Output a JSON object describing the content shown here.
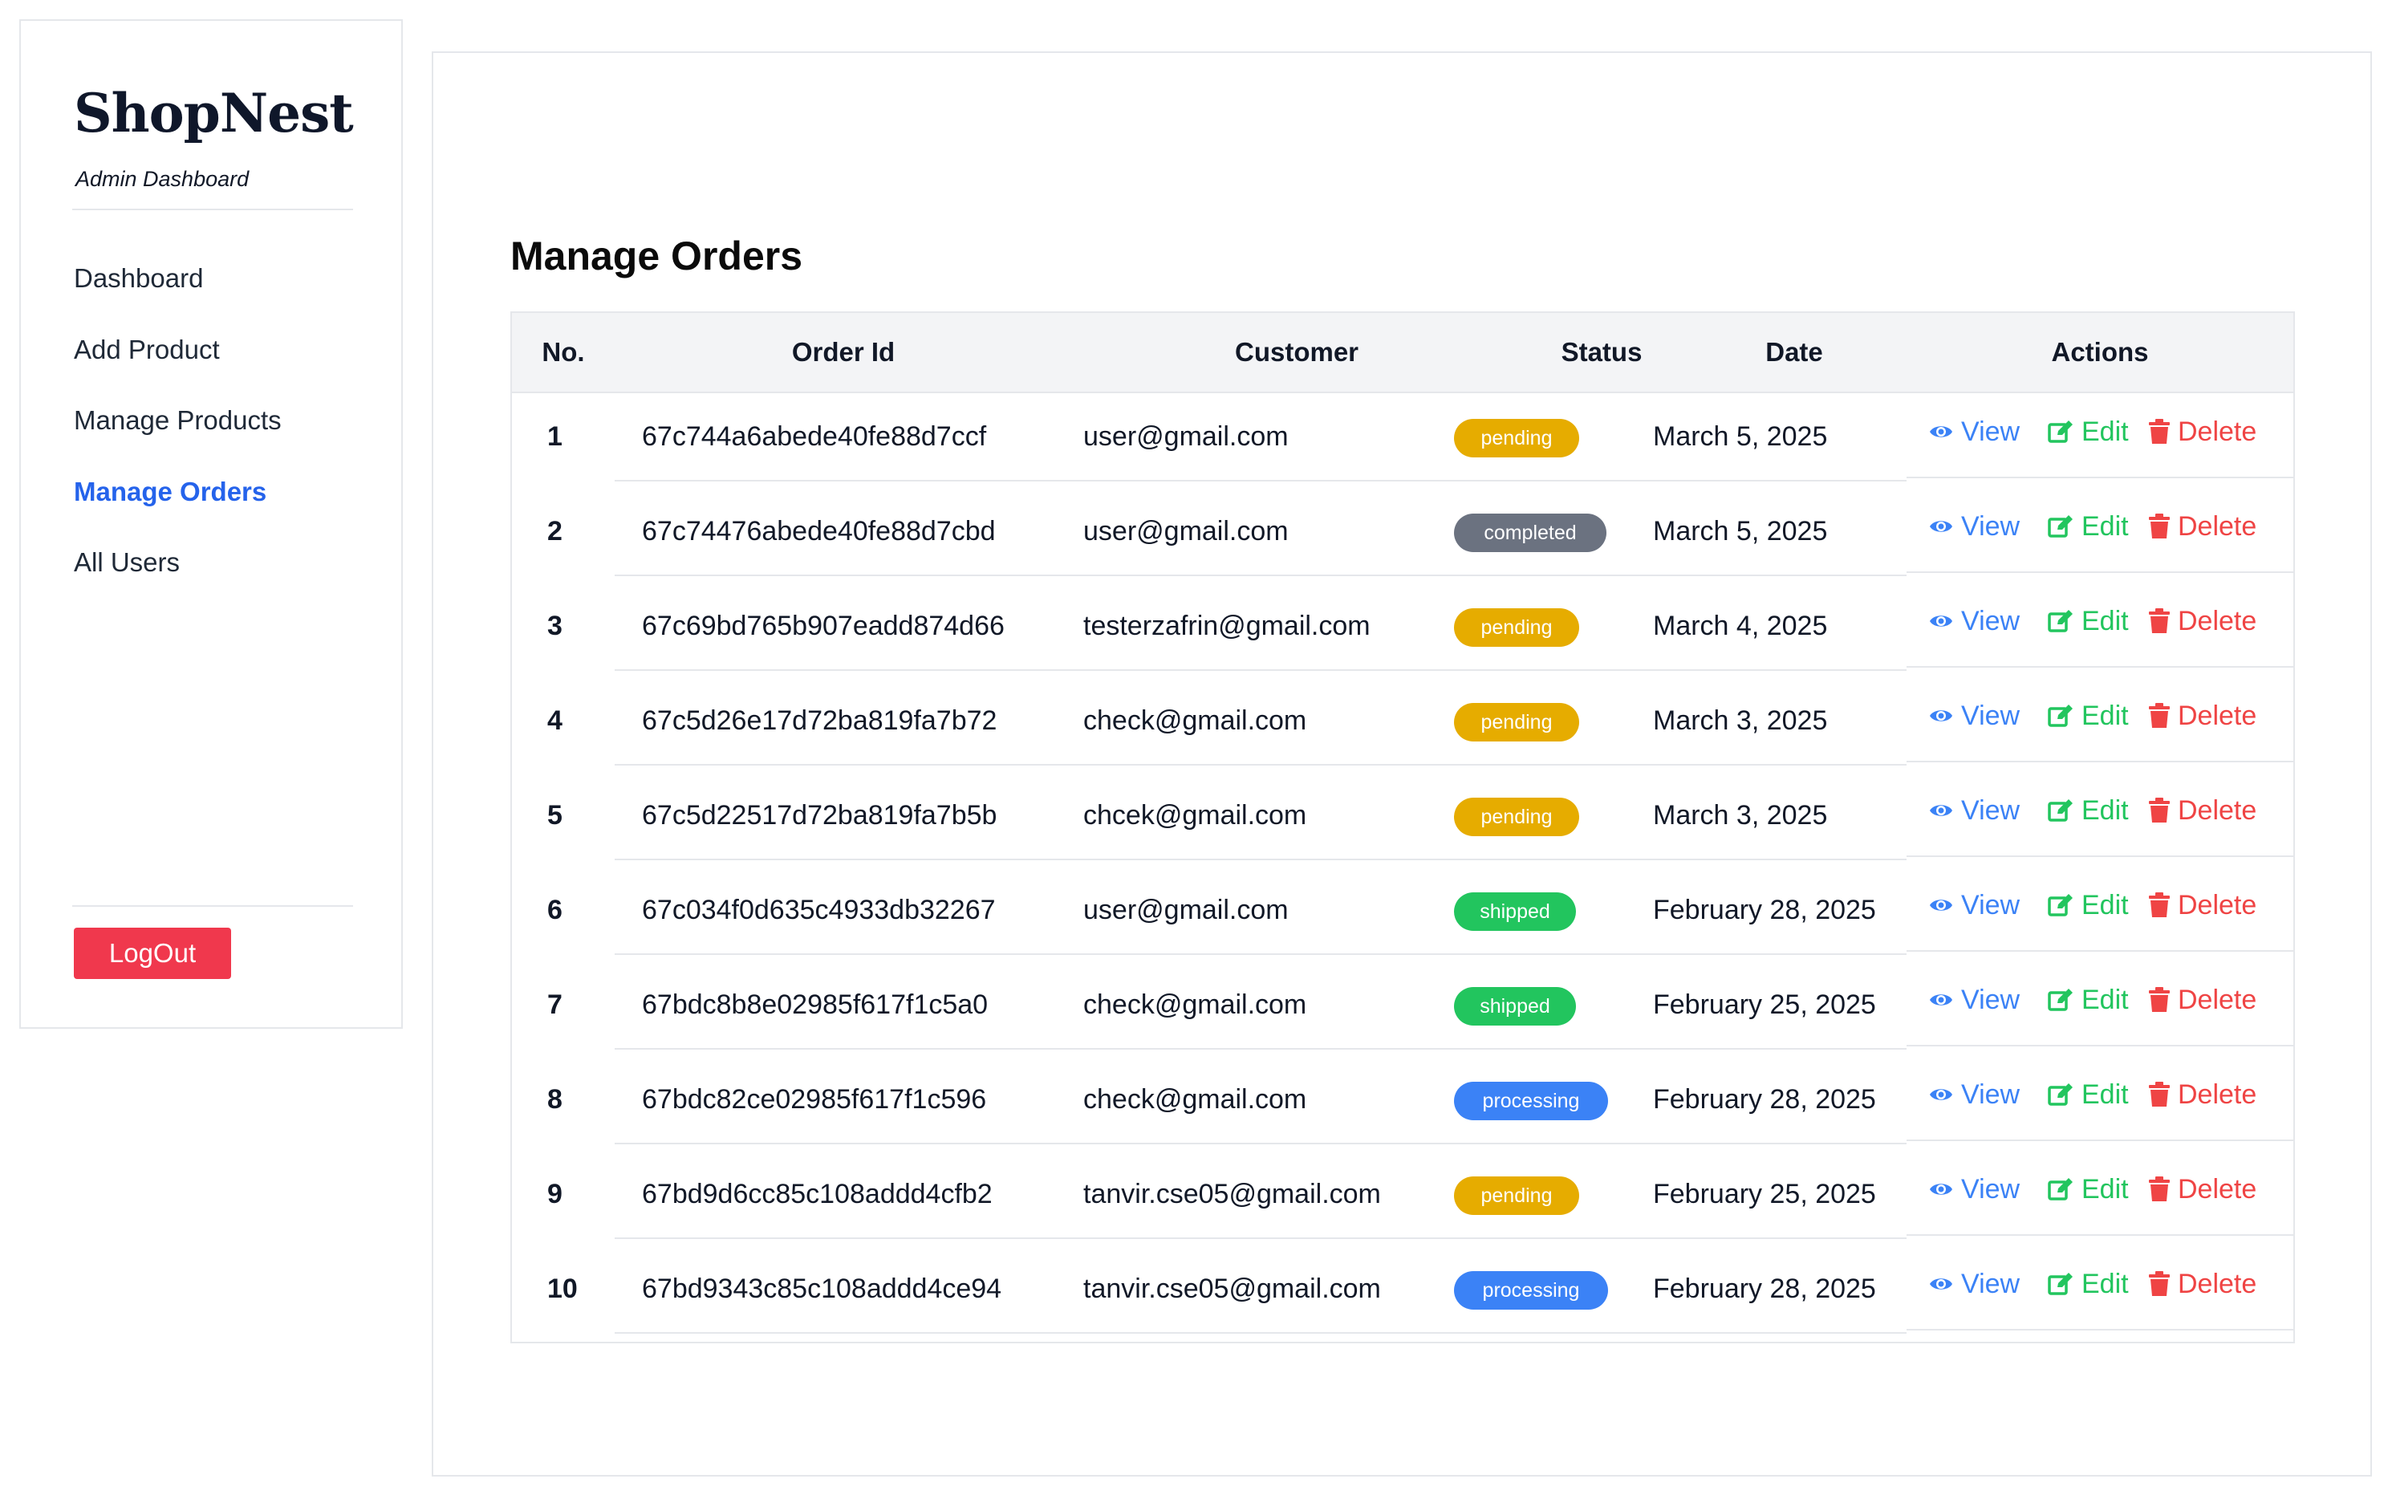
{
  "sidebar": {
    "brand": "ShopNest",
    "subtitle": "Admin Dashboard",
    "nav": [
      {
        "label": "Dashboard",
        "active": false
      },
      {
        "label": "Add Product",
        "active": false
      },
      {
        "label": "Manage Products",
        "active": false
      },
      {
        "label": "Manage Orders",
        "active": true
      },
      {
        "label": "All Users",
        "active": false
      }
    ],
    "logout_label": "LogOut"
  },
  "main": {
    "title": "Manage Orders",
    "columns": [
      "No.",
      "Order Id",
      "Customer",
      "Status",
      "Date",
      "Actions"
    ],
    "actions": {
      "view": "View",
      "edit": "Edit",
      "delete": "Delete"
    },
    "status_colors": {
      "pending": "#e6ac00",
      "completed": "#6b7280",
      "shipped": "#22c55e",
      "processing": "#3b82f6"
    },
    "orders": [
      {
        "no": "1",
        "order_id": "67c744a6abede40fe88d7ccf",
        "customer": "user@gmail.com",
        "status": "pending",
        "date": "March 5, 2025"
      },
      {
        "no": "2",
        "order_id": "67c74476abede40fe88d7cbd",
        "customer": "user@gmail.com",
        "status": "completed",
        "date": "March 5, 2025"
      },
      {
        "no": "3",
        "order_id": "67c69bd765b907eadd874d66",
        "customer": "testerzafrin@gmail.com",
        "status": "pending",
        "date": "March 4, 2025"
      },
      {
        "no": "4",
        "order_id": "67c5d26e17d72ba819fa7b72",
        "customer": "check@gmail.com",
        "status": "pending",
        "date": "March 3, 2025"
      },
      {
        "no": "5",
        "order_id": "67c5d22517d72ba819fa7b5b",
        "customer": "chcek@gmail.com",
        "status": "pending",
        "date": "March 3, 2025"
      },
      {
        "no": "6",
        "order_id": "67c034f0d635c4933db32267",
        "customer": "user@gmail.com",
        "status": "shipped",
        "date": "February 28, 2025"
      },
      {
        "no": "7",
        "order_id": "67bdc8b8e02985f617f1c5a0",
        "customer": "check@gmail.com",
        "status": "shipped",
        "date": "February 25, 2025"
      },
      {
        "no": "8",
        "order_id": "67bdc82ce02985f617f1c596",
        "customer": "check@gmail.com",
        "status": "processing",
        "date": "February 28, 2025"
      },
      {
        "no": "9",
        "order_id": "67bd9d6cc85c108addd4cfb2",
        "customer": "tanvir.cse05@gmail.com",
        "status": "pending",
        "date": "February 25, 2025"
      },
      {
        "no": "10",
        "order_id": "67bd9343c85c108addd4ce94",
        "customer": "tanvir.cse05@gmail.com",
        "status": "processing",
        "date": "February 28, 2025"
      }
    ]
  }
}
